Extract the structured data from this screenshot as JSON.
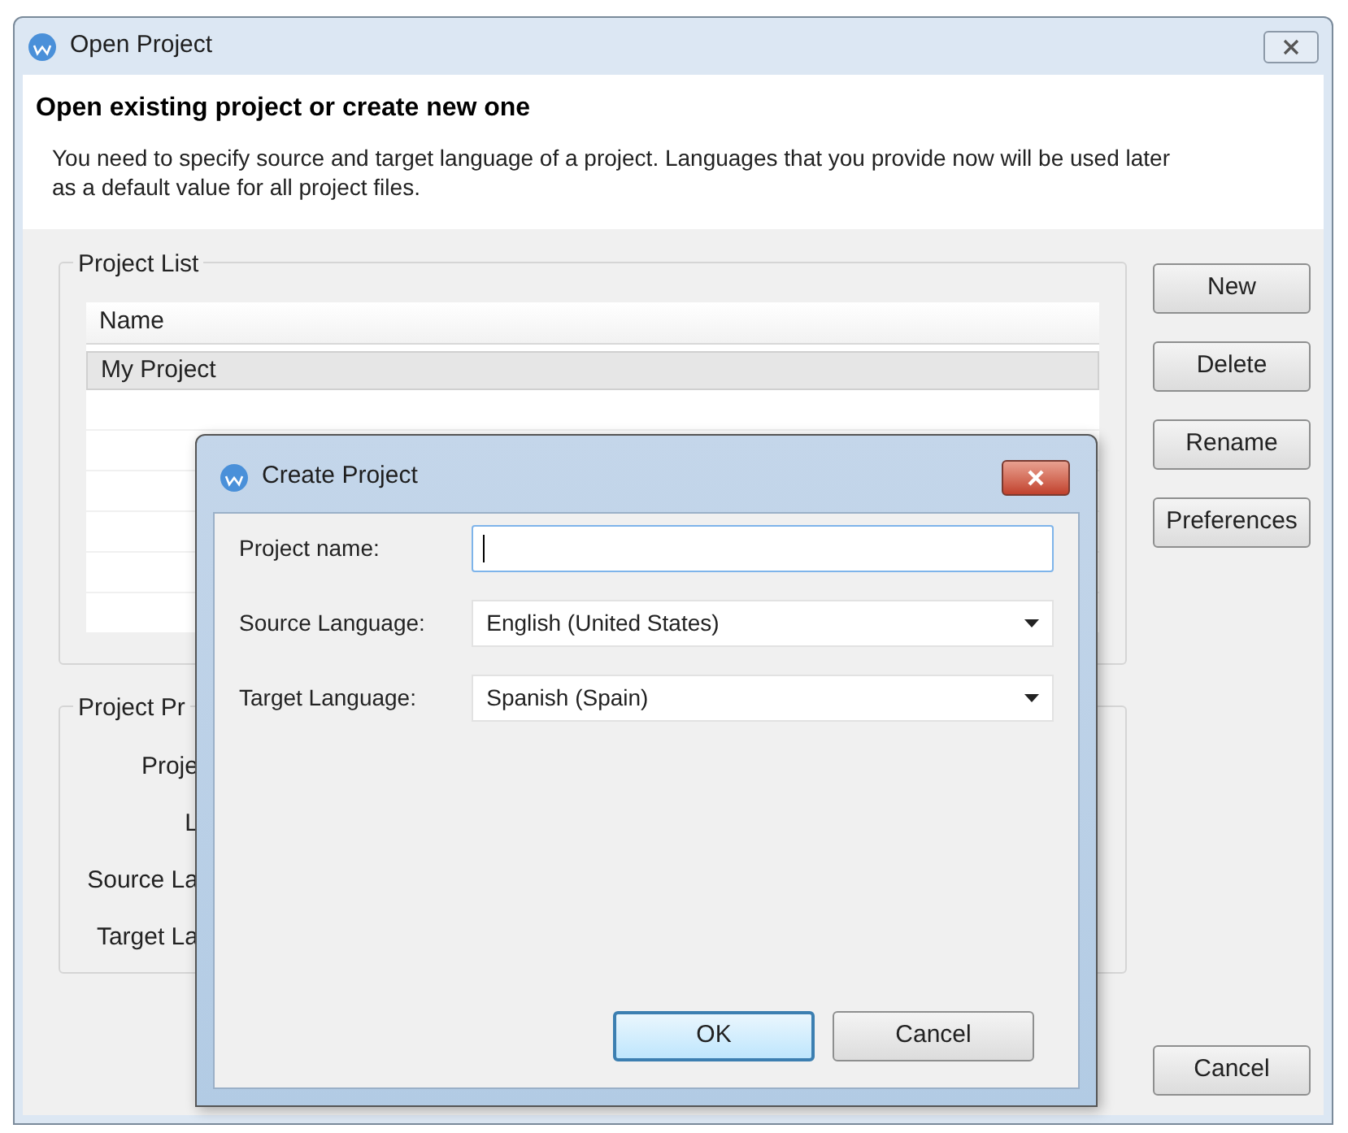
{
  "window": {
    "title": "Open Project",
    "heading": "Open existing project or create new one",
    "description": "You need to specify source and target language of a project. Languages that you provide now will be used later as a default value for all project files."
  },
  "project_list": {
    "title": "Project List",
    "columns": [
      "Name"
    ],
    "rows": [
      {
        "name": "My Project",
        "selected": true
      }
    ]
  },
  "side_buttons": [
    "New",
    "Delete",
    "Rename",
    "Preferences"
  ],
  "project_properties": {
    "title": "Project Pr",
    "labels": [
      "Proje",
      "L",
      "Source La",
      "Target La"
    ]
  },
  "footer_buttons": [
    "Cancel"
  ],
  "dialog": {
    "title": "Create Project",
    "fields": [
      {
        "kind": "text",
        "label": "Project name:",
        "focused": true
      },
      {
        "kind": "select",
        "label": "Source Language:",
        "value": "English (United States)",
        "focused": false
      },
      {
        "kind": "select",
        "label": "Target Language:",
        "value": "Spanish (Spain)",
        "focused": false
      }
    ],
    "buttons": [
      {
        "label": "OK",
        "default": true
      },
      {
        "label": "Cancel",
        "default": false
      }
    ]
  }
}
